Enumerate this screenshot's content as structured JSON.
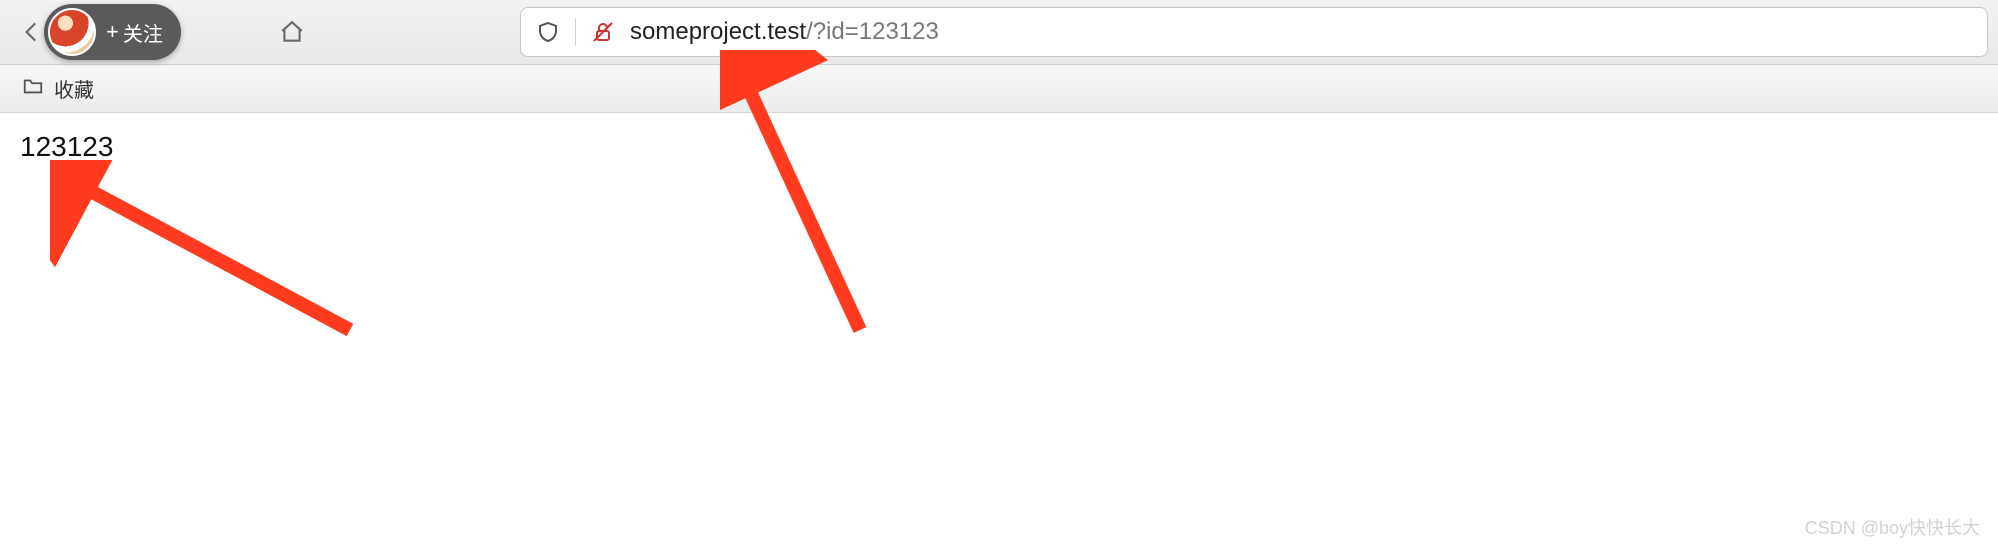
{
  "toolbar": {
    "follow_label": "关注",
    "url_display": "someproject.test/?id=123123",
    "url_host": "someproject.test",
    "url_rest": "/?id=123123"
  },
  "bookmarks": {
    "favorites_label": "收藏"
  },
  "page": {
    "body_text": "123123"
  },
  "icons": {
    "back": "back-icon",
    "reload": "reload-icon",
    "home": "home-icon",
    "shield": "shield-icon",
    "lock_off": "lock-slash-icon",
    "folder": "folder-icon",
    "plus": "+"
  },
  "annotations": {
    "arrow_color": "#ff3b1f"
  },
  "watermark": "CSDN @boy快快长大"
}
